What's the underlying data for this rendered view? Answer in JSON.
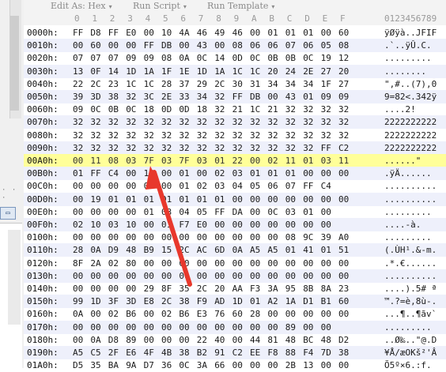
{
  "toolbar": {
    "items": [
      "Edit As: Hex",
      "Run Script",
      "Run Template"
    ]
  },
  "header": {
    "columns": [
      "0",
      "1",
      "2",
      "3",
      "4",
      "5",
      "6",
      "7",
      "8",
      "9",
      "A",
      "B",
      "C",
      "D",
      "E",
      "F"
    ],
    "ascii_header": "0123456789"
  },
  "rows": [
    {
      "addr": "0000h:",
      "bytes": [
        "FF",
        "D8",
        "FF",
        "E0",
        "00",
        "10",
        "4A",
        "46",
        "49",
        "46",
        "00",
        "01",
        "01",
        "01",
        "00",
        "60"
      ],
      "ascii": "ÿØÿà..JFIF"
    },
    {
      "addr": "0010h:",
      "bytes": [
        "00",
        "60",
        "00",
        "00",
        "FF",
        "DB",
        "00",
        "43",
        "00",
        "08",
        "06",
        "06",
        "07",
        "06",
        "05",
        "08"
      ],
      "ascii": ".`..ÿÛ.C."
    },
    {
      "addr": "0020h:",
      "bytes": [
        "07",
        "07",
        "07",
        "09",
        "09",
        "08",
        "0A",
        "0C",
        "14",
        "0D",
        "0C",
        "0B",
        "0B",
        "0C",
        "19",
        "12"
      ],
      "ascii": "........."
    },
    {
      "addr": "0030h:",
      "bytes": [
        "13",
        "0F",
        "14",
        "1D",
        "1A",
        "1F",
        "1E",
        "1D",
        "1A",
        "1C",
        "1C",
        "20",
        "24",
        "2E",
        "27",
        "20"
      ],
      "ascii": "........"
    },
    {
      "addr": "0040h:",
      "bytes": [
        "22",
        "2C",
        "23",
        "1C",
        "1C",
        "28",
        "37",
        "29",
        "2C",
        "30",
        "31",
        "34",
        "34",
        "34",
        "1F",
        "27"
      ],
      "ascii": "\",#..(7),0"
    },
    {
      "addr": "0050h:",
      "bytes": [
        "39",
        "3D",
        "38",
        "32",
        "3C",
        "2E",
        "33",
        "34",
        "32",
        "FF",
        "DB",
        "00",
        "43",
        "01",
        "09",
        "09"
      ],
      "ascii": "9=82<.342ÿ"
    },
    {
      "addr": "0060h:",
      "bytes": [
        "09",
        "0C",
        "0B",
        "0C",
        "18",
        "0D",
        "0D",
        "18",
        "32",
        "21",
        "1C",
        "21",
        "32",
        "32",
        "32",
        "32"
      ],
      "ascii": "....2!"
    },
    {
      "addr": "0070h:",
      "bytes": [
        "32",
        "32",
        "32",
        "32",
        "32",
        "32",
        "32",
        "32",
        "32",
        "32",
        "32",
        "32",
        "32",
        "32",
        "32",
        "32"
      ],
      "ascii": "2222222222"
    },
    {
      "addr": "0080h:",
      "bytes": [
        "32",
        "32",
        "32",
        "32",
        "32",
        "32",
        "32",
        "32",
        "32",
        "32",
        "32",
        "32",
        "32",
        "32",
        "32",
        "32"
      ],
      "ascii": "2222222222"
    },
    {
      "addr": "0090h:",
      "bytes": [
        "32",
        "32",
        "32",
        "32",
        "32",
        "32",
        "32",
        "32",
        "32",
        "32",
        "32",
        "32",
        "32",
        "32",
        "FF",
        "C2"
      ],
      "ascii": "2222222222"
    },
    {
      "addr": "00A0h:",
      "bytes": [
        "00",
        "11",
        "08",
        "03",
        "7F",
        "03",
        "7F",
        "03",
        "01",
        "22",
        "00",
        "02",
        "11",
        "01",
        "03",
        "11"
      ],
      "ascii": "......\""
    },
    {
      "addr": "00B0h:",
      "bytes": [
        "01",
        "FF",
        "C4",
        "00",
        "1B",
        "00",
        "01",
        "00",
        "02",
        "03",
        "01",
        "01",
        "01",
        "00",
        "00",
        "00"
      ],
      "ascii": ".ÿÄ......"
    },
    {
      "addr": "00C0h:",
      "bytes": [
        "00",
        "00",
        "00",
        "00",
        "00",
        "00",
        "01",
        "02",
        "03",
        "04",
        "05",
        "06",
        "07",
        "FF",
        "C4"
      ],
      "ascii": ".........."
    },
    {
      "addr": "00D0h:",
      "bytes": [
        "00",
        "19",
        "01",
        "01",
        "01",
        "01",
        "01",
        "01",
        "01",
        "00",
        "00",
        "00",
        "00",
        "00",
        "00",
        "00"
      ],
      "ascii": ".........."
    },
    {
      "addr": "00E0h:",
      "bytes": [
        "00",
        "00",
        "00",
        "00",
        "01",
        "03",
        "04",
        "05",
        "FF",
        "DA",
        "00",
        "0C",
        "03",
        "01",
        "00"
      ],
      "ascii": "........."
    },
    {
      "addr": "00F0h:",
      "bytes": [
        "02",
        "10",
        "03",
        "10",
        "00",
        "01",
        "F7",
        "E0",
        "00",
        "00",
        "00",
        "00",
        "00",
        "00",
        "00"
      ],
      "ascii": "....-à."
    },
    {
      "addr": "0100h:",
      "bytes": [
        "00",
        "00",
        "00",
        "00",
        "00",
        "00",
        "00",
        "00",
        "00",
        "00",
        "00",
        "00",
        "08",
        "9C",
        "39",
        "A0"
      ],
      "ascii": "........."
    },
    {
      "addr": "0110h:",
      "bytes": [
        "28",
        "0A",
        "D9",
        "48",
        "B9",
        "15",
        "2C",
        "AC",
        "6D",
        "0A",
        "A5",
        "A5",
        "01",
        "41",
        "01",
        "51"
      ],
      "ascii": "(.ÙH¹.&-m."
    },
    {
      "addr": "0120h:",
      "bytes": [
        "8F",
        "2A",
        "02",
        "80",
        "00",
        "00",
        "00",
        "00",
        "00",
        "00",
        "00",
        "00",
        "00",
        "00",
        "00",
        "00"
      ],
      "ascii": ".*.€......"
    },
    {
      "addr": "0130h:",
      "bytes": [
        "00",
        "00",
        "00",
        "00",
        "00",
        "00",
        "00",
        "00",
        "00",
        "00",
        "00",
        "00",
        "00",
        "00",
        "00",
        "00"
      ],
      "ascii": ".........."
    },
    {
      "addr": "0140h:",
      "bytes": [
        "00",
        "00",
        "00",
        "00",
        "29",
        "8F",
        "35",
        "2C",
        "20",
        "AA",
        "F3",
        "3A",
        "95",
        "8B",
        "8A",
        "23"
      ],
      "ascii": "....).5# ª"
    },
    {
      "addr": "0150h:",
      "bytes": [
        "99",
        "1D",
        "3F",
        "3D",
        "E8",
        "2C",
        "38",
        "F9",
        "AD",
        "1D",
        "01",
        "A2",
        "1A",
        "D1",
        "B1",
        "60"
      ],
      "ascii": "™.?=è,8ù-."
    },
    {
      "addr": "0160h:",
      "bytes": [
        "0A",
        "00",
        "02",
        "B6",
        "00",
        "02",
        "B6",
        "E3",
        "76",
        "60",
        "28",
        "00",
        "00",
        "00",
        "00",
        "00"
      ],
      "ascii": "...¶..¶ãv`"
    },
    {
      "addr": "0170h:",
      "bytes": [
        "00",
        "00",
        "00",
        "00",
        "00",
        "00",
        "00",
        "00",
        "00",
        "00",
        "00",
        "00",
        "89",
        "00",
        "00"
      ],
      "ascii": "........."
    },
    {
      "addr": "0180h:",
      "bytes": [
        "00",
        "0A",
        "D8",
        "89",
        "00",
        "00",
        "00",
        "22",
        "40",
        "00",
        "44",
        "81",
        "48",
        "BC",
        "48",
        "D2"
      ],
      "ascii": "..Ø‰..\"@.D"
    },
    {
      "addr": "0190h:",
      "bytes": [
        "A5",
        "C5",
        "2F",
        "E6",
        "4F",
        "4B",
        "38",
        "B2",
        "91",
        "C2",
        "EE",
        "F8",
        "88",
        "F4",
        "7D",
        "38"
      ],
      "ascii": "¥Å/æOKš²'Â"
    },
    {
      "addr": "01A0h:",
      "bytes": [
        "D5",
        "35",
        "BA",
        "9A",
        "D7",
        "36",
        "0C",
        "3A",
        "66",
        "00",
        "00",
        "00",
        "2B",
        "13",
        "00",
        "00"
      ],
      "ascii": "Õ5º×6.:f."
    }
  ],
  "colors": {
    "highlight_row": "#ffff99",
    "alt_row": "#eef0fb",
    "arrow": "#e8382c"
  }
}
